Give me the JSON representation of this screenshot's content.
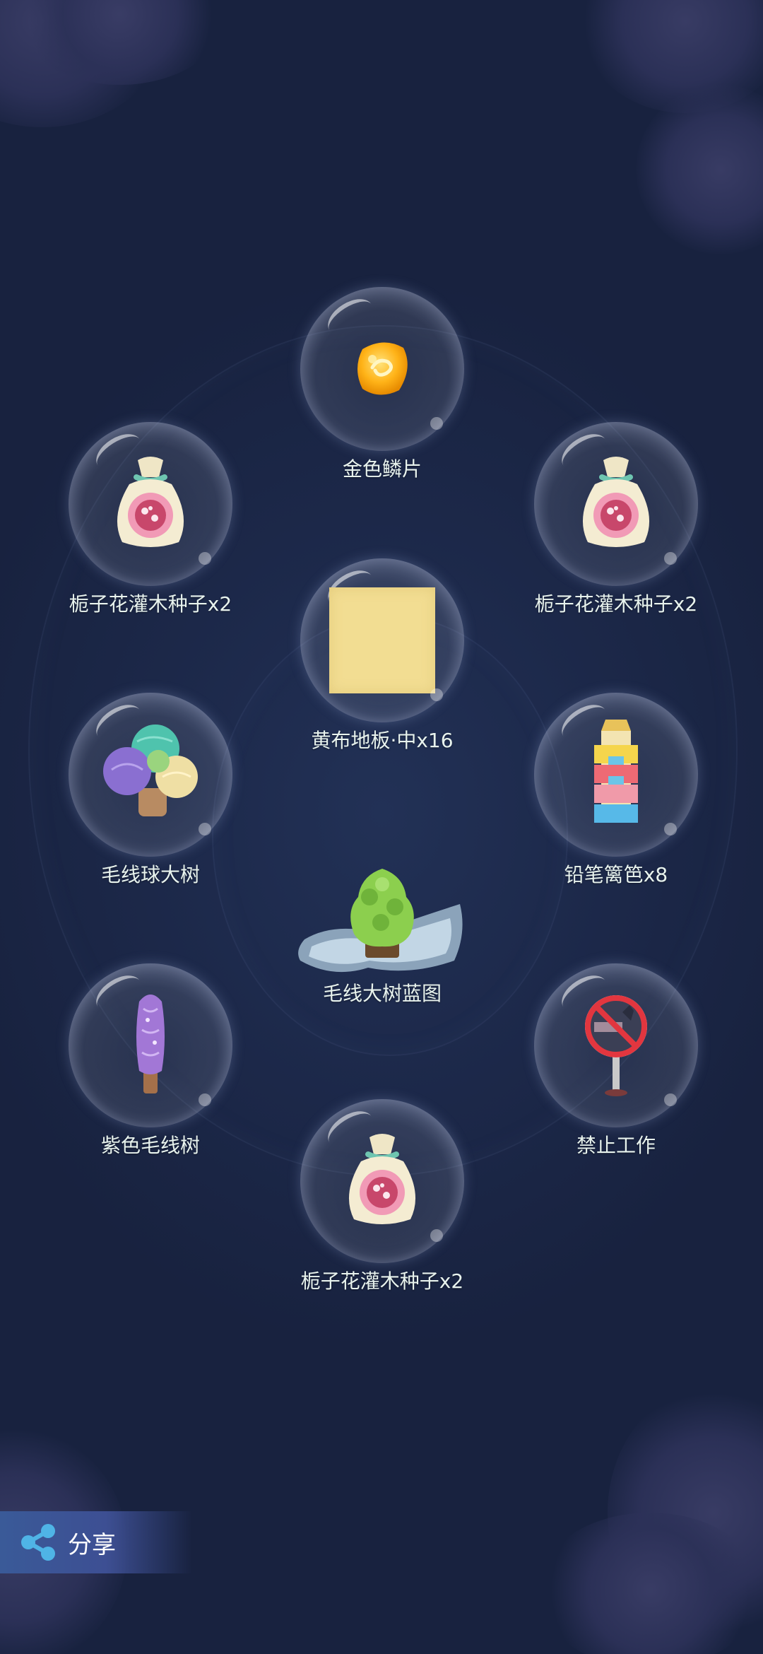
{
  "items": {
    "golden_scale": {
      "label": "金色鳞片",
      "icon": "golden-scale-icon"
    },
    "seed_left": {
      "label": "栀子花灌木种子x2",
      "icon": "seed-bag-icon"
    },
    "seed_right": {
      "label": "栀子花灌木种子x2",
      "icon": "seed-bag-icon"
    },
    "yellow_floor": {
      "label": "黄布地板·中x16",
      "icon": "yellow-cloth-floor-icon"
    },
    "yarn_tree": {
      "label": "毛线球大树",
      "icon": "yarn-ball-tree-icon"
    },
    "pencil_fence": {
      "label": "铅笔篱笆x8",
      "icon": "pencil-fence-icon"
    },
    "blueprint": {
      "label": "毛线大树蓝图",
      "icon": "blueprint-icon"
    },
    "purple_tree": {
      "label": "紫色毛线树",
      "icon": "purple-yarn-tree-icon"
    },
    "no_work": {
      "label": "禁止工作",
      "icon": "no-work-sign-icon"
    },
    "seed_bottom": {
      "label": "栀子花灌木种子x2",
      "icon": "seed-bag-icon"
    }
  },
  "share": {
    "label": "分享",
    "icon": "share-icon"
  },
  "colors": {
    "background": "#1b2746",
    "label_text": "#e8f3ee",
    "share_bg": "#3a5a98"
  }
}
